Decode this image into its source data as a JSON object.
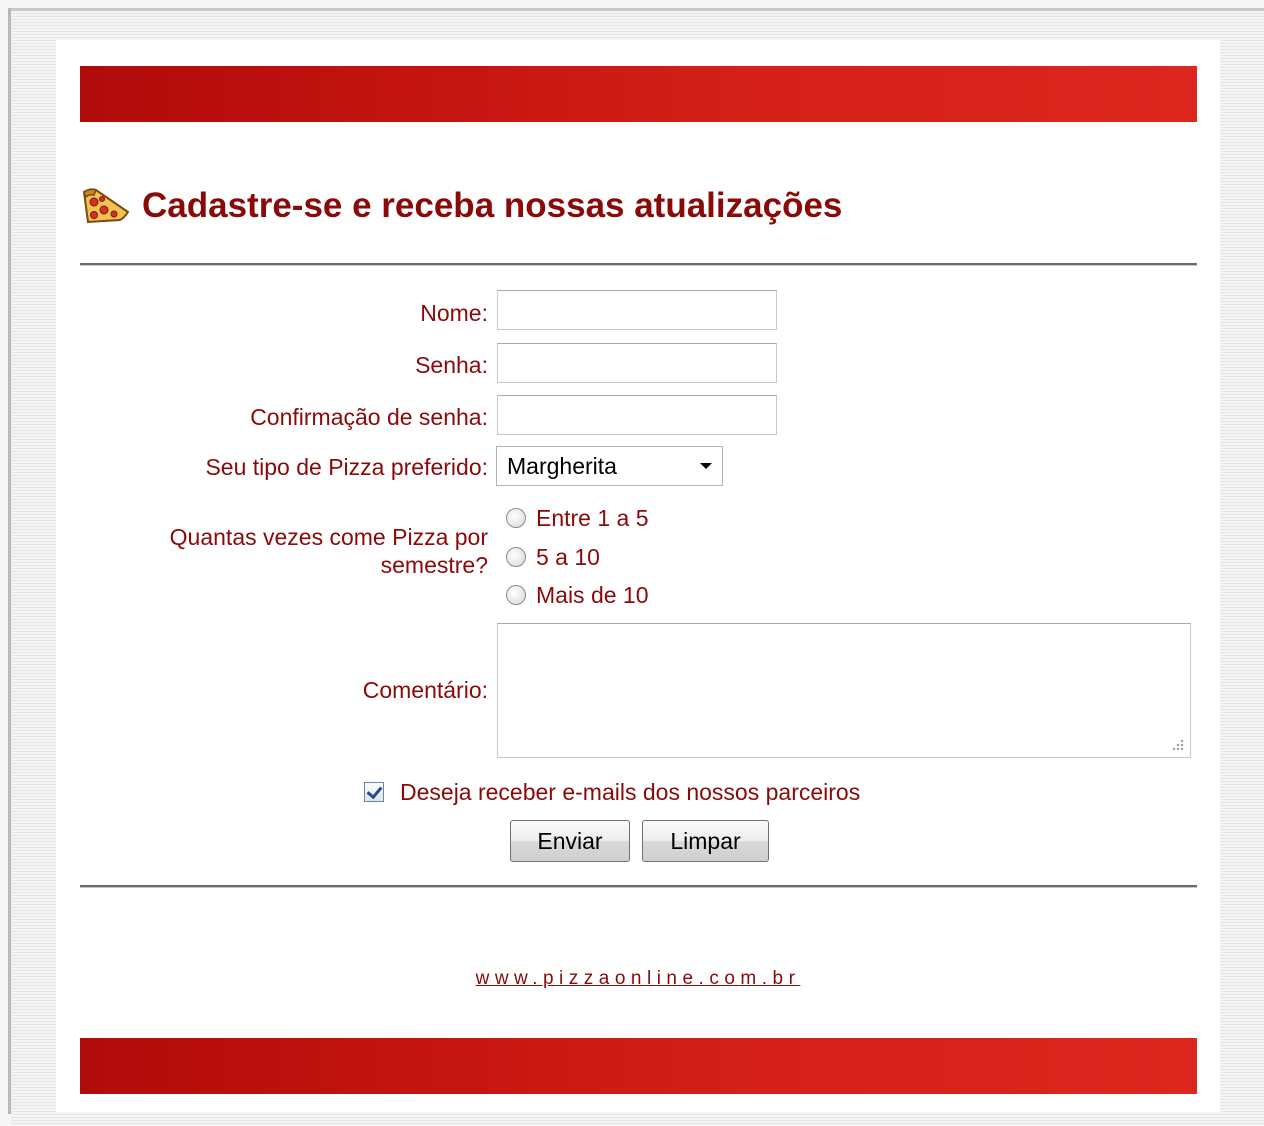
{
  "page": {
    "title": "Cadastre-se e receba nossas atualizações",
    "footer_url": "www.pizzaonline.com.br"
  },
  "colors": {
    "accent": "#8a0a0a",
    "band_start": "#b00b0b",
    "band_end": "#dc261e"
  },
  "icons": {
    "title_icon": "pizza-slice-icon"
  },
  "form": {
    "name_label": "Nome:",
    "name_value": "",
    "password_label": "Senha:",
    "password_value": "",
    "password_confirm_label": "Confirmação de senha:",
    "password_confirm_value": "",
    "pizza_type_label": "Seu tipo de Pizza preferido:",
    "pizza_type_selected": "Margherita",
    "frequency_label": "Quantas vezes come Pizza por semestre?",
    "frequency_options": [
      {
        "label": "Entre 1 a 5",
        "checked": false
      },
      {
        "label": "5 a 10",
        "checked": false
      },
      {
        "label": "Mais de 10",
        "checked": false
      }
    ],
    "comment_label": "Comentário:",
    "comment_value": "",
    "partners_checkbox_label": "Deseja receber e-mails dos nossos parceiros",
    "partners_checkbox_checked": true,
    "submit_label": "Enviar",
    "reset_label": "Limpar"
  }
}
